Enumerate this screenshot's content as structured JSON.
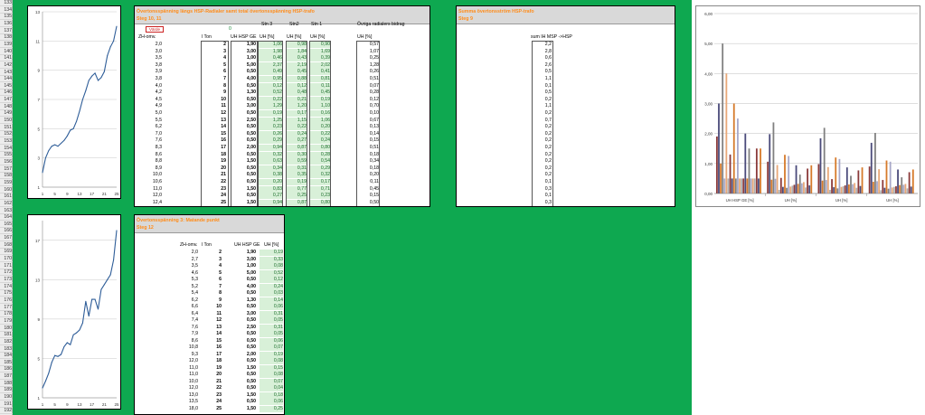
{
  "row_numbers": [
    "133",
    "134",
    "135",
    "136",
    "137",
    "138",
    "139",
    "140",
    "141",
    "142",
    "143",
    "144",
    "145",
    "146",
    "147",
    "148",
    "149",
    "150",
    "151",
    "152",
    "153",
    "154",
    "155",
    "156",
    "157",
    "158",
    "159",
    "160",
    "161",
    "162",
    "163",
    "164",
    "165",
    "166",
    "167",
    "168",
    "169",
    "170",
    "171",
    "172",
    "173",
    "174",
    "175",
    "176",
    "177",
    "178",
    "179",
    "180",
    "181",
    "182",
    "183",
    "184",
    "185",
    "186",
    "187",
    "188",
    "189",
    "190",
    "191",
    "192"
  ],
  "chart1": {
    "type": "line",
    "x": [
      1,
      2,
      3,
      4,
      5,
      6,
      7,
      8,
      9,
      10,
      11,
      12,
      13,
      14,
      15,
      16,
      17,
      18,
      19,
      20,
      21,
      22,
      23,
      24,
      25
    ],
    "values": [
      2.0,
      3.0,
      3.5,
      3.8,
      3.9,
      3.8,
      4.0,
      4.2,
      4.5,
      4.9,
      5.0,
      5.5,
      6.2,
      7.0,
      7.6,
      8.3,
      8.6,
      8.8,
      8.3,
      8.5,
      8.9,
      10.0,
      10.6,
      11.0,
      12.0
    ],
    "yticks": [
      "1",
      "3",
      "5",
      "7",
      "9",
      "11",
      "13"
    ],
    "xticks": [
      "1",
      "5",
      "9",
      "13",
      "17",
      "21",
      "25"
    ],
    "ylim": [
      1,
      13
    ],
    "line_color": "#2e5d98"
  },
  "chart2": {
    "type": "line",
    "x": [
      1,
      2,
      3,
      4,
      5,
      6,
      7,
      8,
      9,
      10,
      11,
      12,
      13,
      14,
      15,
      16,
      17,
      18,
      19,
      20,
      21,
      22,
      23,
      24,
      25
    ],
    "values": [
      2.0,
      2.7,
      3.5,
      4.6,
      5.3,
      5.2,
      5.4,
      6.2,
      6.6,
      6.4,
      7.4,
      7.6,
      7.9,
      8.6,
      10.8,
      9.3,
      11.0,
      11.0,
      10.0,
      12.0,
      12.5,
      13.0,
      13.5,
      15.0,
      18.0
    ],
    "yticks": [
      "1",
      "5",
      "9",
      "13",
      "17"
    ],
    "xticks": [
      "1",
      "5",
      "9",
      "13",
      "17",
      "21",
      "25"
    ],
    "ylim": [
      1,
      19
    ],
    "line_color": "#2e5d98"
  },
  "panel1": {
    "title1": "Övertonsspänning längs HSP-Radialer samt total övertonsspänning HSP-trafo",
    "title2": "Steg 10, 11",
    "red_label": "Värde",
    "green_label": "0",
    "col_stn3": "Stn 3",
    "col_stn2": "Stn2",
    "col_stn1": "Stn 1",
    "col_ovriga": "Övriga radialers bidrag",
    "col_zh": "ZH-omv.",
    "col_ton": "l Ton",
    "col_uh": "UH HSP GE",
    "col_uh1": "UH [%]",
    "col_uh2": "UH [%]",
    "col_uh3": "UH [%]",
    "col_uh4": "UH [%]"
  },
  "table1": [
    [
      "2,0",
      "2",
      "1,90",
      "1,06",
      "0,98",
      "0,90",
      "0,57"
    ],
    [
      "3,0",
      "3",
      "3,00",
      "1,98",
      "1,84",
      "1,69",
      "1,07"
    ],
    [
      "3,5",
      "4",
      "1,00",
      "0,46",
      "0,43",
      "0,39",
      "0,25"
    ],
    [
      "3,8",
      "5",
      "5,00",
      "2,37",
      "2,19",
      "2,02",
      "1,28"
    ],
    [
      "3,9",
      "6",
      "0,50",
      "0,49",
      "0,45",
      "0,41",
      "0,26"
    ],
    [
      "3,8",
      "7",
      "4,00",
      "0,95",
      "0,88",
      "0,81",
      "0,51"
    ],
    [
      "4,0",
      "8",
      "0,50",
      "0,12",
      "0,12",
      "0,11",
      "0,07"
    ],
    [
      "4,2",
      "9",
      "1,30",
      "0,52",
      "0,48",
      "0,45",
      "0,28"
    ],
    [
      "4,5",
      "10",
      "0,50",
      "0,22",
      "0,21",
      "0,19",
      "0,12"
    ],
    [
      "4,9",
      "11",
      "3,00",
      "1,29",
      "1,20",
      "1,10",
      "0,70"
    ],
    [
      "5,0",
      "12",
      "0,50",
      "0,19",
      "0,17",
      "0,16",
      "0,10"
    ],
    [
      "5,5",
      "13",
      "2,50",
      "1,25",
      "1,15",
      "1,06",
      "0,67"
    ],
    [
      "6,2",
      "14",
      "0,50",
      "0,23",
      "0,22",
      "0,20",
      "0,13"
    ],
    [
      "7,0",
      "15",
      "0,50",
      "0,26",
      "0,24",
      "0,22",
      "0,14"
    ],
    [
      "7,6",
      "16",
      "0,50",
      "0,29",
      "0,27",
      "0,24",
      "0,15"
    ],
    [
      "8,3",
      "17",
      "2,00",
      "0,94",
      "0,87",
      "0,80",
      "0,51"
    ],
    [
      "8,6",
      "18",
      "0,50",
      "0,32",
      "0,30",
      "0,28",
      "0,18"
    ],
    [
      "8,8",
      "19",
      "1,50",
      "0,63",
      "0,59",
      "0,54",
      "0,34"
    ],
    [
      "8,9",
      "20",
      "0,50",
      "0,34",
      "0,31",
      "0,29",
      "0,18"
    ],
    [
      "10,0",
      "21",
      "0,50",
      "0,38",
      "0,35",
      "0,32",
      "0,20"
    ],
    [
      "10,6",
      "22",
      "0,50",
      "0,20",
      "0,19",
      "0,17",
      "0,11"
    ],
    [
      "11,0",
      "23",
      "1,50",
      "0,83",
      "0,77",
      "0,71",
      "0,45"
    ],
    [
      "12,0",
      "24",
      "0,50",
      "0,27",
      "0,25",
      "0,23",
      "0,15"
    ],
    [
      "12,4",
      "25",
      "1,50",
      "0,94",
      "0,87",
      "0,80",
      "0,50"
    ]
  ],
  "panel2": {
    "title1": "Övertonsspänning 3: Matande punkt",
    "title2": "Steg 12",
    "col_zh": "ZH-omv.",
    "col_ton": "l Ton",
    "col_uh": "UH HSP GE",
    "col_uhp": "UH [%]"
  },
  "table2": [
    [
      "2,0",
      "2",
      "1,90",
      "0,19"
    ],
    [
      "2,7",
      "3",
      "3,00",
      "0,33"
    ],
    [
      "3,5",
      "4",
      "1,00",
      "0,08"
    ],
    [
      "4,6",
      "5",
      "5,00",
      "0,52"
    ],
    [
      "5,3",
      "6",
      "0,50",
      "0,12"
    ],
    [
      "5,2",
      "7",
      "4,00",
      "0,24"
    ],
    [
      "5,4",
      "8",
      "0,50",
      "0,03"
    ],
    [
      "6,2",
      "9",
      "1,30",
      "0,14"
    ],
    [
      "6,6",
      "10",
      "0,50",
      "0,06"
    ],
    [
      "6,4",
      "11",
      "3,00",
      "0,31"
    ],
    [
      "7,4",
      "12",
      "0,50",
      "0,05"
    ],
    [
      "7,6",
      "13",
      "2,50",
      "0,31"
    ],
    [
      "7,9",
      "14",
      "0,50",
      "0,05"
    ],
    [
      "8,6",
      "15",
      "0,50",
      "0,06"
    ],
    [
      "10,8",
      "16",
      "0,50",
      "0,07"
    ],
    [
      "9,3",
      "17",
      "2,00",
      "0,19"
    ],
    [
      "12,0",
      "18",
      "0,50",
      "0,08"
    ],
    [
      "11,0",
      "19",
      "1,50",
      "0,15"
    ],
    [
      "11,0",
      "20",
      "0,50",
      "0,08"
    ],
    [
      "10,0",
      "21",
      "0,50",
      "0,07"
    ],
    [
      "12,0",
      "22",
      "0,50",
      "0,04"
    ],
    [
      "13,0",
      "23",
      "1,50",
      "0,18"
    ],
    [
      "13,5",
      "24",
      "0,50",
      "0,06"
    ],
    [
      "18,0",
      "25",
      "1,50",
      "0,25"
    ]
  ],
  "panel3": {
    "title1": "Summa övertonsström HSP-trafo",
    "title2": "Steg 9",
    "col_label": "sum IH MSP ->HSP",
    "values": [
      "2,2",
      "2,8",
      "0,6",
      "2,6",
      "0,5",
      "1,1",
      "0,1",
      "0,5",
      "0,2",
      "1,1",
      "0,2",
      "0,7",
      "0,2",
      "0,2",
      "0,2",
      "0,2",
      "0,2",
      "0,2",
      "0,2",
      "0,2",
      "0,1",
      "0,3",
      "0,1",
      "0,3"
    ]
  },
  "bar_chart": {
    "type": "bar",
    "yticks": [
      "0,00",
      "1,00",
      "2,00",
      "3,00",
      "4,00",
      "5,00",
      "6,00"
    ],
    "ylim": [
      0,
      6
    ],
    "categories": [
      "UH HSP GE [%]",
      "UH [%]",
      "UH [%]",
      "UH [%]"
    ],
    "colors": [
      "#8b3a3a",
      "#4a4a7a",
      "#d67a2a",
      "#808080",
      "#a8a8c8",
      "#e8a878",
      "#b0b0b0"
    ],
    "groups": [
      [
        1.9,
        3.0,
        1.0,
        5.0,
        0.5,
        4.0,
        0.5,
        1.3,
        0.5,
        3.0,
        0.5,
        2.5,
        0.5,
        0.5,
        0.5,
        2.0,
        0.5,
        1.5,
        0.5,
        0.5,
        0.5,
        1.5,
        0.5,
        1.5
      ],
      [
        1.06,
        1.98,
        0.46,
        2.37,
        0.49,
        0.95,
        0.12,
        0.52,
        0.22,
        1.29,
        0.19,
        1.25,
        0.23,
        0.26,
        0.29,
        0.94,
        0.32,
        0.63,
        0.34,
        0.38,
        0.2,
        0.83,
        0.27,
        0.94
      ],
      [
        0.98,
        1.84,
        0.43,
        2.19,
        0.45,
        0.88,
        0.12,
        0.48,
        0.21,
        1.2,
        0.17,
        1.15,
        0.22,
        0.24,
        0.27,
        0.87,
        0.3,
        0.59,
        0.31,
        0.35,
        0.19,
        0.77,
        0.25,
        0.87
      ],
      [
        0.9,
        1.69,
        0.39,
        2.02,
        0.41,
        0.81,
        0.11,
        0.45,
        0.19,
        1.1,
        0.16,
        1.06,
        0.2,
        0.22,
        0.24,
        0.8,
        0.28,
        0.54,
        0.29,
        0.32,
        0.17,
        0.71,
        0.23,
        0.8
      ]
    ]
  }
}
